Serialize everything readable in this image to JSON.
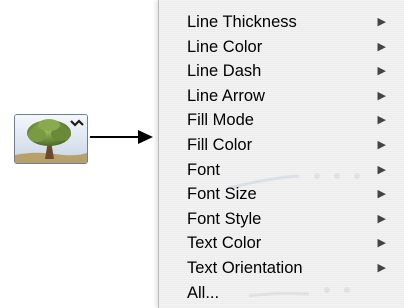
{
  "tool_icon": {
    "name": "tree-picture-icon",
    "colors": {
      "foliage": "#6f8f3c",
      "trunk": "#6b4a2b",
      "sky": "#dfe8f2",
      "frame": "#6d7f95"
    }
  },
  "pointer": {
    "name": "right-arrow-icon"
  },
  "menu": {
    "items": [
      {
        "label": "Line Thickness",
        "submenu": true
      },
      {
        "label": "Line Color",
        "submenu": true
      },
      {
        "label": "Line Dash",
        "submenu": true
      },
      {
        "label": "Line Arrow",
        "submenu": true
      },
      {
        "label": "Fill Mode",
        "submenu": true
      },
      {
        "label": "Fill Color",
        "submenu": true
      },
      {
        "label": "Font",
        "submenu": true
      },
      {
        "label": "Font Size",
        "submenu": true
      },
      {
        "label": "Font Style",
        "submenu": true
      },
      {
        "label": "Text Color",
        "submenu": true
      },
      {
        "label": "Text Orientation",
        "submenu": true
      },
      {
        "label": "All...",
        "submenu": false
      }
    ],
    "submenu_glyph": "▶",
    "colors": {
      "background": "#f3f3f3",
      "text": "#000000",
      "arrow": "#444444"
    }
  }
}
